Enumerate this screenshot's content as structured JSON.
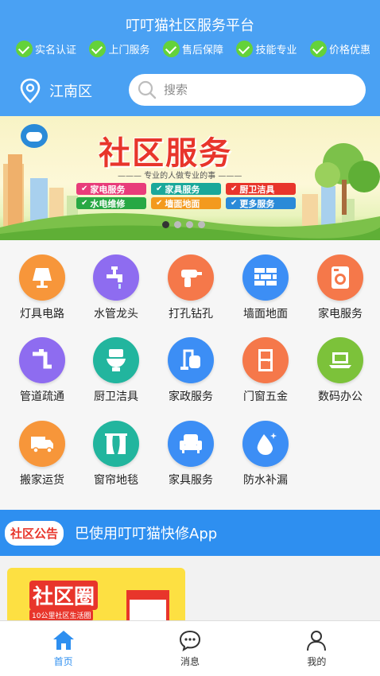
{
  "header": {
    "title": "叮叮猫社区服务平台",
    "badges": [
      "实名认证",
      "上门服务",
      "售后保障",
      "技能专业",
      "价格优惠"
    ],
    "location": "江南区",
    "search_placeholder": "搜索"
  },
  "banner": {
    "title": "社区服务",
    "subtitle": "——— 专业的人做专业的事 ———",
    "tags": [
      "家电服务",
      "家具服务",
      "厨卫洁具",
      "水电维修",
      "墙面地面",
      "更多服务"
    ],
    "tag_colors": [
      "#e83c7a",
      "#1aa89a",
      "#e8352b",
      "#27a844",
      "#f39a1e",
      "#2a8ad8"
    ],
    "active_slide": 1,
    "slide_count": 4
  },
  "services": [
    {
      "label": "灯具电路",
      "icon": "lamp-icon",
      "color": "#f7963a"
    },
    {
      "label": "水管龙头",
      "icon": "faucet-icon",
      "color": "#8e6cf0"
    },
    {
      "label": "打孔钻孔",
      "icon": "drill-icon",
      "color": "#f5784a"
    },
    {
      "label": "墙面地面",
      "icon": "brick-wall-icon",
      "color": "#3c8ef5"
    },
    {
      "label": "家电服务",
      "icon": "washing-machine-icon",
      "color": "#f5784a"
    },
    {
      "label": "管道疏通",
      "icon": "pipe-icon",
      "color": "#8e6cf0"
    },
    {
      "label": "厨卫洁具",
      "icon": "toilet-icon",
      "color": "#22b59e"
    },
    {
      "label": "家政服务",
      "icon": "vacuum-icon",
      "color": "#3c8ef5"
    },
    {
      "label": "门窗五金",
      "icon": "door-icon",
      "color": "#f5784a"
    },
    {
      "label": "数码办公",
      "icon": "laptop-icon",
      "color": "#7cc23a"
    },
    {
      "label": "搬家运货",
      "icon": "truck-icon",
      "color": "#f7963a"
    },
    {
      "label": "窗帘地毯",
      "icon": "curtain-icon",
      "color": "#22b59e"
    },
    {
      "label": "家具服务",
      "icon": "sofa-icon",
      "color": "#3c8ef5"
    },
    {
      "label": "防水补漏",
      "icon": "water-drop-icon",
      "color": "#3c8ef5"
    }
  ],
  "notice": {
    "tag": "社区公告",
    "text": "巴使用叮叮猫快修App"
  },
  "community_card": {
    "title": "社区圈",
    "subtitle": "10公里社区生活圈"
  },
  "tabbar": {
    "tabs": [
      {
        "label": "首页",
        "icon": "home-icon",
        "active": true
      },
      {
        "label": "消息",
        "icon": "message-icon",
        "active": false
      },
      {
        "label": "我的",
        "icon": "user-icon",
        "active": false
      }
    ]
  },
  "colors": {
    "header_bg": "#4aa1f3",
    "accent": "#2e8ff0",
    "check": "#64d23a",
    "notice_tag": "#e8352b"
  }
}
